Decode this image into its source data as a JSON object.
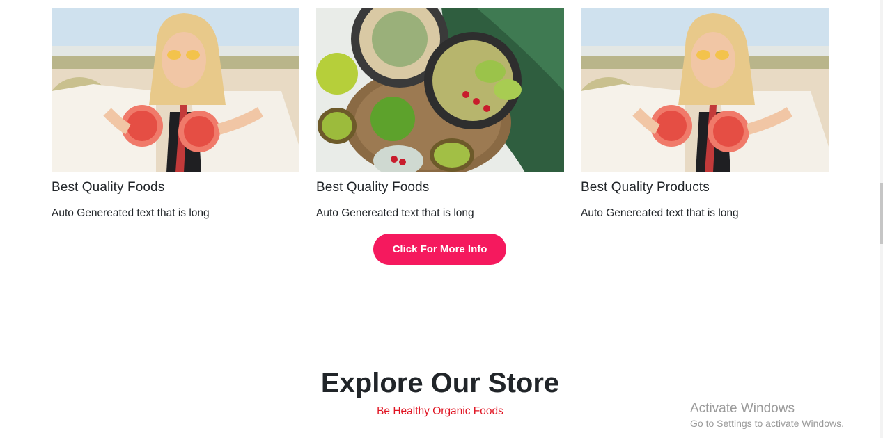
{
  "cards": [
    {
      "title": "Best Quality Foods",
      "text": "Auto Genereated text that is long",
      "image": "woman-with-grapefruit-photo"
    },
    {
      "title": "Best Quality Foods",
      "text": "Auto Genereated text that is long",
      "image": "smoothie-bowls-photo"
    },
    {
      "title": "Best Quality Products",
      "text": "Auto Genereated text that is long",
      "image": "woman-with-grapefruit-photo"
    }
  ],
  "more_button": "Click For More Info",
  "store": {
    "title": "Explore Our Store",
    "subtitle": "Be Healthy Organic Foods"
  },
  "watermark": {
    "title": "Activate Windows",
    "subtitle": "Go to Settings to activate Windows."
  },
  "colors": {
    "accent": "#f5195e",
    "subtitle": "#e01422",
    "text": "#212529"
  }
}
